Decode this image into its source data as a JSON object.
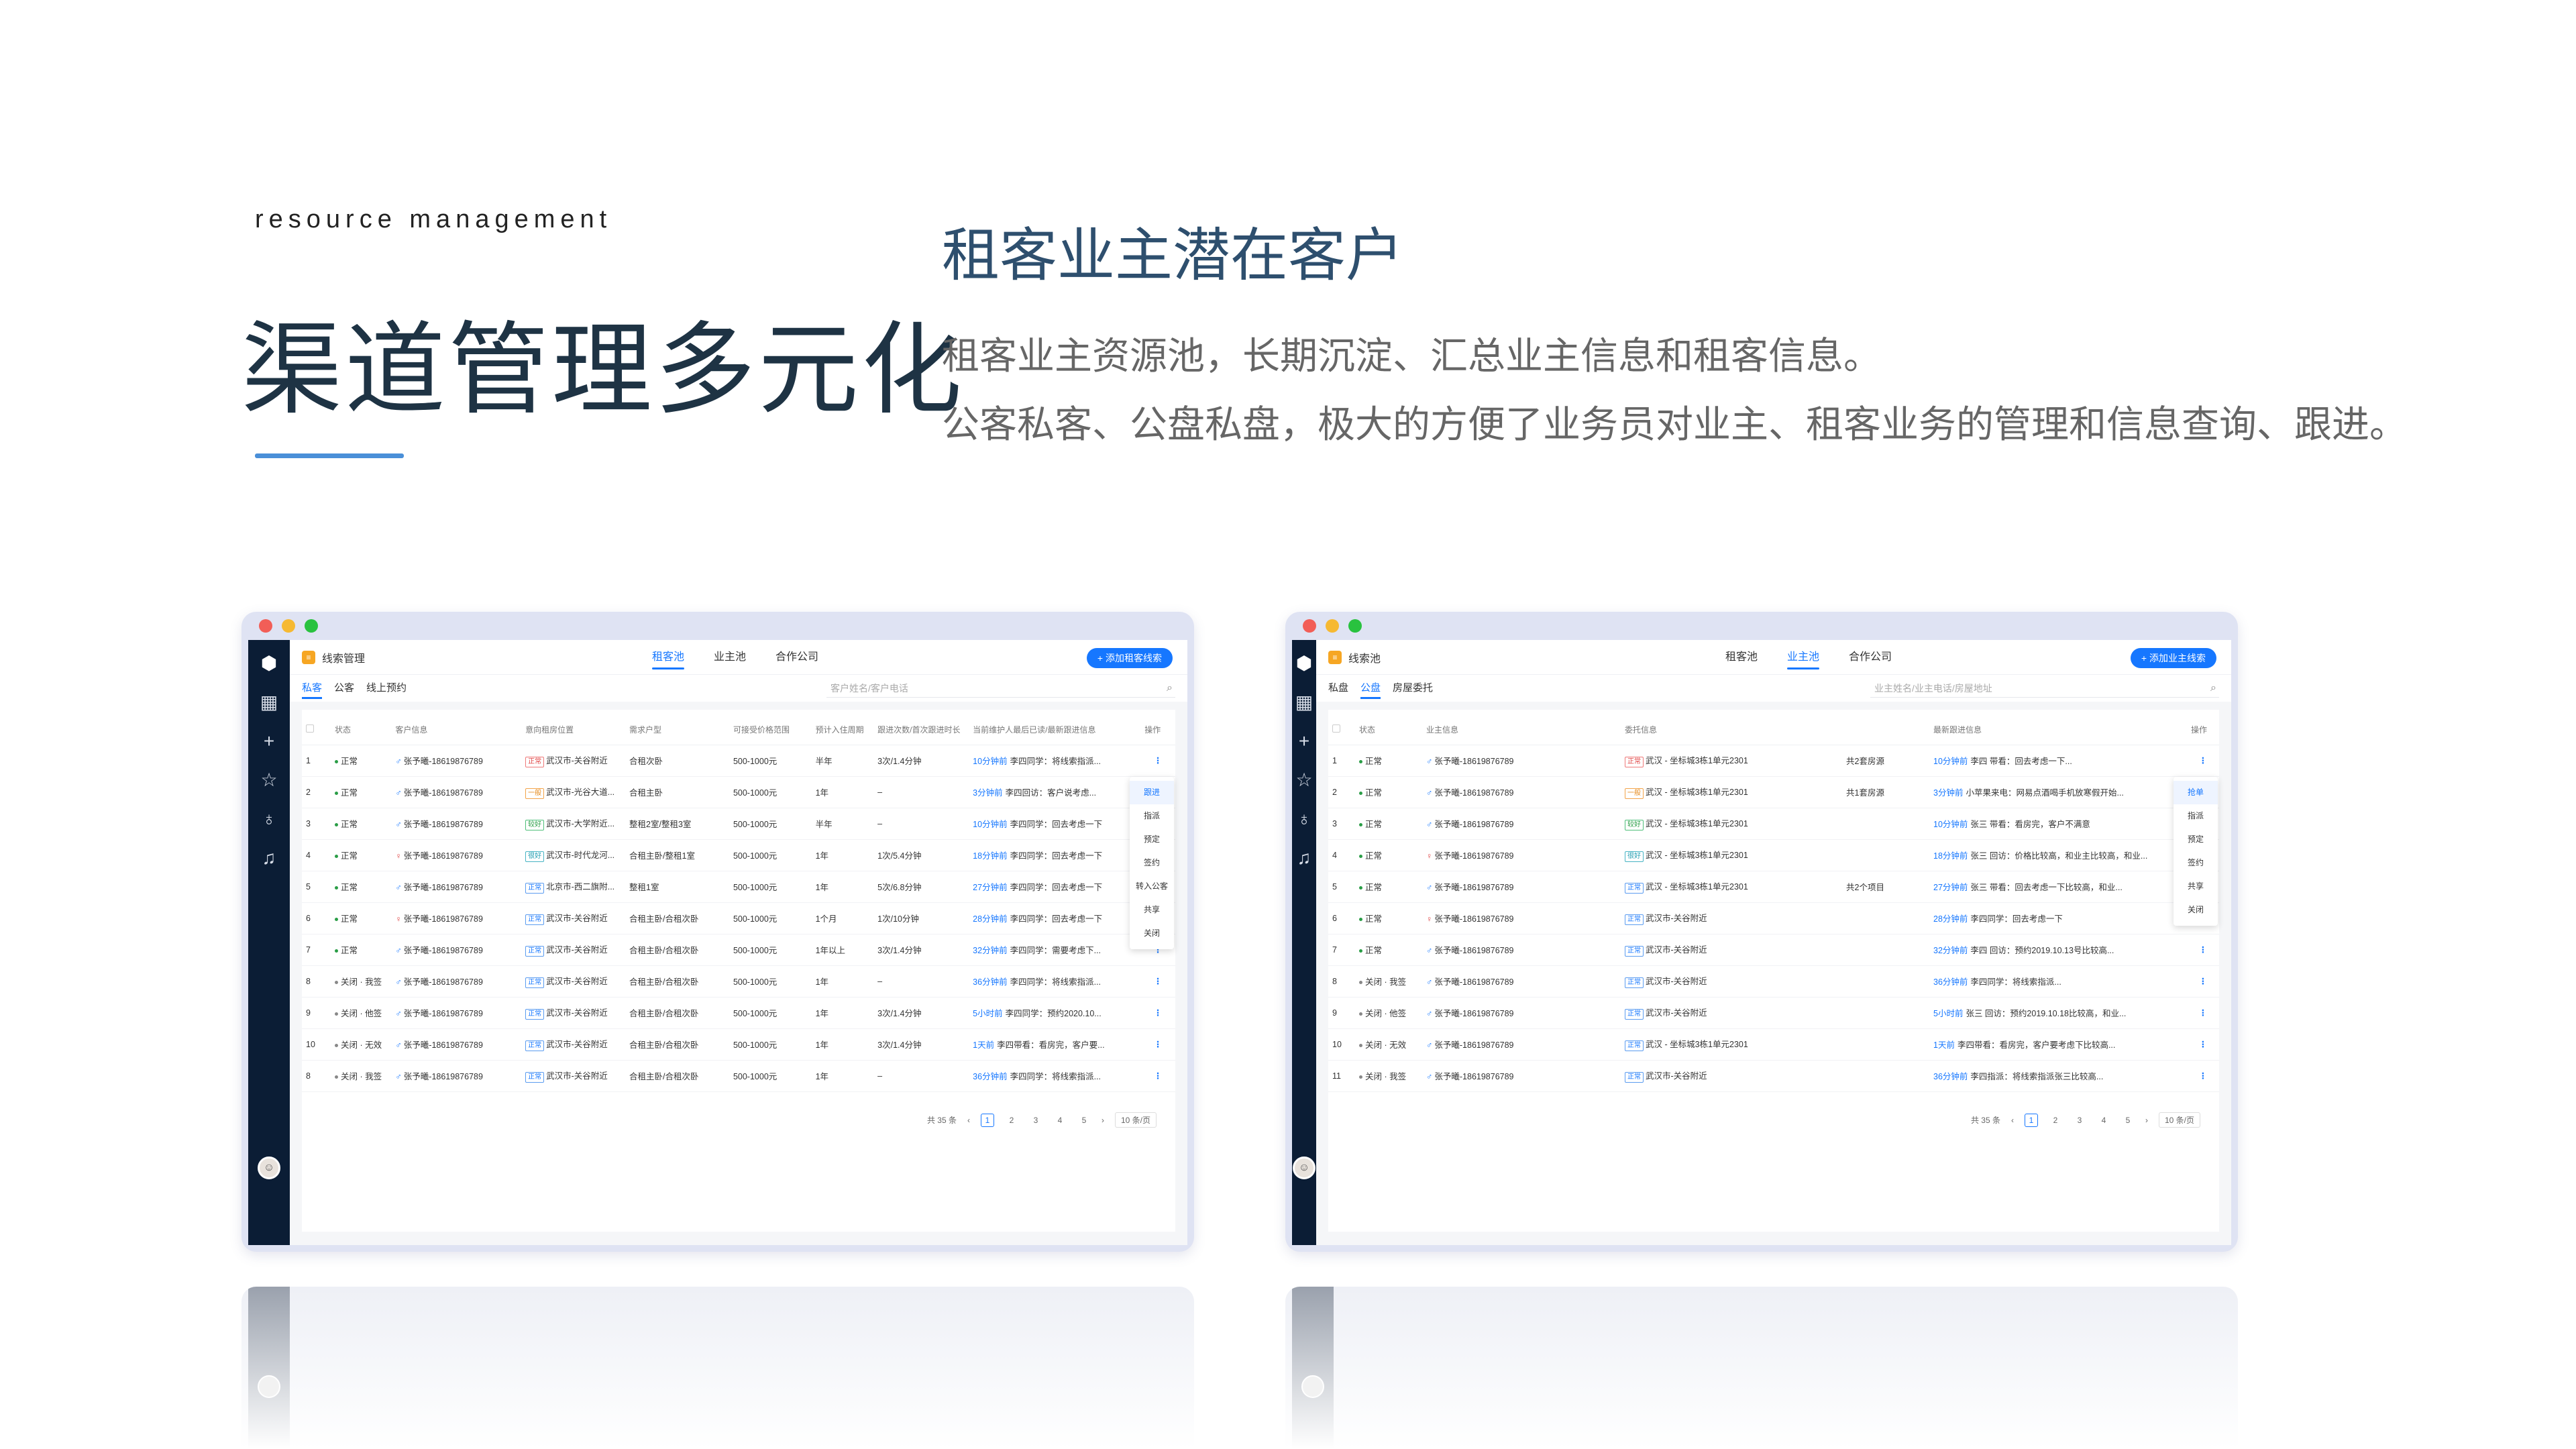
{
  "header": {
    "eyebrow": "resource management",
    "title": "渠道管理多元化",
    "section_title": "租客业主潜在客户",
    "desc1": "租客业主资源池，长期沉淀、汇总业主信息和租客信息。",
    "desc2": "公客私客、公盘私盘，极大的方便了业务员对业主、租客业务的管理和信息查询、跟进。"
  },
  "colors": {
    "accent": "#1677ff",
    "sidebar": "#0b1d35",
    "title": "#1e3344",
    "bar": "#4a8fd8"
  },
  "left": {
    "crumb": "线索管理",
    "tabs": [
      "租客池",
      "业主池",
      "合作公司"
    ],
    "active_tab": 0,
    "add_button": "+ 添加租客线索",
    "subtabs": [
      "私客",
      "公客",
      "线上预约"
    ],
    "search_placeholder": "客户姓名/客户电话",
    "columns": [
      "",
      "状态",
      "客户信息",
      "意向租房位置",
      "需求户型",
      "可接受价格范围",
      "预计入住周期",
      "跟进次数/首次跟进时长",
      "当前维护人最后已读/最新跟进信息",
      "操作"
    ],
    "rows": [
      {
        "no": "1",
        "status": "正常",
        "closed": false,
        "pin": "blue",
        "customer": "张予曦-18619876789",
        "tag": "正常",
        "tagc": "red",
        "loc": "武汉市-关谷附近",
        "type": "合租次卧",
        "price": "500-1000元",
        "period": "半年",
        "follow": "3次/1.4分钟",
        "time": "10分钟前",
        "info": "李四同学：将线索指派..."
      },
      {
        "no": "2",
        "status": "正常",
        "closed": false,
        "pin": "blue",
        "customer": "张予曦-18619876789",
        "tag": "一般",
        "tagc": "orange",
        "loc": "武汉市-光谷大道...",
        "type": "合租主卧",
        "price": "500-1000元",
        "period": "1年",
        "follow": "–",
        "time": "3分钟前",
        "info": "李四回访：客户说考虑..."
      },
      {
        "no": "3",
        "status": "正常",
        "closed": false,
        "pin": "blue",
        "customer": "张予曦-18619876789",
        "tag": "较好",
        "tagc": "green",
        "loc": "武汉市-大学附近...",
        "type": "整租2室/整租3室",
        "price": "500-1000元",
        "period": "半年",
        "follow": "–",
        "time": "10分钟前",
        "info": "李四同学：回去考虑一下"
      },
      {
        "no": "4",
        "status": "正常",
        "closed": false,
        "pin": "red",
        "customer": "张予曦-18619876789",
        "tag": "很好",
        "tagc": "teal",
        "loc": "武汉市-时代龙河...",
        "type": "合租主卧/整租1室",
        "price": "500-1000元",
        "period": "1年",
        "follow": "1次/5.4分钟",
        "time": "18分钟前",
        "info": "李四同学：回去考虑一下"
      },
      {
        "no": "5",
        "status": "正常",
        "closed": false,
        "pin": "blue",
        "customer": "张予曦-18619876789",
        "tag": "正常",
        "tagc": "blue",
        "loc": "北京市-西二旗附...",
        "type": "整租1室",
        "price": "500-1000元",
        "period": "1年",
        "follow": "5次/6.8分钟",
        "time": "27分钟前",
        "info": "李四同学：回去考虑一下"
      },
      {
        "no": "6",
        "status": "正常",
        "closed": false,
        "pin": "red",
        "customer": "张予曦-18619876789",
        "tag": "正常",
        "tagc": "blue",
        "loc": "武汉市-关谷附近",
        "type": "合租主卧/合租次卧",
        "price": "500-1000元",
        "period": "1个月",
        "follow": "1次/10分钟",
        "time": "28分钟前",
        "info": "李四同学：回去考虑一下"
      },
      {
        "no": "7",
        "status": "正常",
        "closed": false,
        "pin": "blue",
        "customer": "张予曦-18619876789",
        "tag": "正常",
        "tagc": "blue",
        "loc": "武汉市-关谷附近",
        "type": "合租主卧/合租次卧",
        "price": "500-1000元",
        "period": "1年以上",
        "follow": "3次/1.4分钟",
        "time": "32分钟前",
        "info": "李四同学：需要考虑下..."
      },
      {
        "no": "8",
        "status": "关闭 · 我签",
        "closed": true,
        "pin": "blue",
        "customer": "张予曦-18619876789",
        "tag": "正常",
        "tagc": "blue",
        "loc": "武汉市-关谷附近",
        "type": "合租主卧/合租次卧",
        "price": "500-1000元",
        "period": "1年",
        "follow": "–",
        "time": "36分钟前",
        "info": "李四同学：将线索指派..."
      },
      {
        "no": "9",
        "status": "关闭 · 他签",
        "closed": true,
        "pin": "blue",
        "customer": "张予曦-18619876789",
        "tag": "正常",
        "tagc": "blue",
        "loc": "武汉市-关谷附近",
        "type": "合租主卧/合租次卧",
        "price": "500-1000元",
        "period": "1年",
        "follow": "3次/1.4分钟",
        "time": "5小时前",
        "info": "李四同学：预约2020.10..."
      },
      {
        "no": "10",
        "status": "关闭 · 无效",
        "closed": true,
        "pin": "blue",
        "customer": "张予曦-18619876789",
        "tag": "正常",
        "tagc": "blue",
        "loc": "武汉市-关谷附近",
        "type": "合租主卧/合租次卧",
        "price": "500-1000元",
        "period": "1年",
        "follow": "3次/1.4分钟",
        "time": "1天前",
        "info": "李四带看：看房完，客户要..."
      },
      {
        "no": "8",
        "status": "关闭 · 我签",
        "closed": true,
        "pin": "blue",
        "customer": "张予曦-18619876789",
        "tag": "正常",
        "tagc": "blue",
        "loc": "武汉市-关谷附近",
        "type": "合租主卧/合租次卧",
        "price": "500-1000元",
        "period": "1年",
        "follow": "–",
        "time": "36分钟前",
        "info": "李四同学：将线索指派..."
      }
    ],
    "menu": [
      "跟进",
      "指派",
      "预定",
      "签约",
      "转入公客",
      "共享",
      "关闭"
    ],
    "pager": {
      "total": "共 35 条",
      "pages": [
        "1",
        "2",
        "3",
        "4",
        "5"
      ],
      "size": "10 条/页"
    }
  },
  "right": {
    "crumb": "线索池",
    "tabs": [
      "租客池",
      "业主池",
      "合作公司"
    ],
    "active_tab": 1,
    "add_button": "+ 添加业主线索",
    "subtabs": [
      "私盘",
      "公盘",
      "房屋委托"
    ],
    "search_placeholder": "业主姓名/业主电话/房屋地址",
    "columns": [
      "",
      "状态",
      "业主信息",
      "委托信息",
      "",
      "最新跟进信息",
      "操作"
    ],
    "rows": [
      {
        "no": "1",
        "status": "正常",
        "closed": false,
        "pin": "blue",
        "owner": "张予曦-18619876789",
        "tag": "正常",
        "tagc": "red",
        "entrust": "武汉 - 坐标城3栋1单元2301",
        "count": "共2套房源",
        "time": "10分钟前",
        "info": "李四 带看：回去考虑一下..."
      },
      {
        "no": "2",
        "status": "正常",
        "closed": false,
        "pin": "blue",
        "owner": "张予曦-18619876789",
        "tag": "一般",
        "tagc": "orange",
        "entrust": "武汉 - 坐标城3栋1单元2301",
        "count": "共1套房源",
        "time": "3分钟前",
        "info": "小苹果来电：网易点酒喝手机放寒假开始..."
      },
      {
        "no": "3",
        "status": "正常",
        "closed": false,
        "pin": "blue",
        "owner": "张予曦-18619876789",
        "tag": "较好",
        "tagc": "green",
        "entrust": "武汉 - 坐标城3栋1单元2301",
        "count": "",
        "time": "10分钟前",
        "info": "张三 带看：看房完，客户不满意"
      },
      {
        "no": "4",
        "status": "正常",
        "closed": false,
        "pin": "red",
        "owner": "张予曦-18619876789",
        "tag": "很好",
        "tagc": "teal",
        "entrust": "武汉 - 坐标城3栋1单元2301",
        "count": "",
        "time": "18分钟前",
        "info": "张三 回访：价格比较高，和业主比较高，和业..."
      },
      {
        "no": "5",
        "status": "正常",
        "closed": false,
        "pin": "blue",
        "owner": "张予曦-18619876789",
        "tag": "正常",
        "tagc": "blue",
        "entrust": "武汉 - 坐标城3栋1单元2301",
        "count": "共2个项目",
        "time": "27分钟前",
        "info": "张三 带看：回去考虑一下比较高，和业..."
      },
      {
        "no": "6",
        "status": "正常",
        "closed": false,
        "pin": "red",
        "owner": "张予曦-18619876789",
        "tag": "正常",
        "tagc": "blue",
        "entrust": "武汉市-关谷附近",
        "count": "",
        "time": "28分钟前",
        "info": "李四同学：回去考虑一下"
      },
      {
        "no": "7",
        "status": "正常",
        "closed": false,
        "pin": "blue",
        "owner": "张予曦-18619876789",
        "tag": "正常",
        "tagc": "blue",
        "entrust": "武汉市-关谷附近",
        "count": "",
        "time": "32分钟前",
        "info": "李四 回访：预约2019.10.13号比较高..."
      },
      {
        "no": "8",
        "status": "关闭 · 我签",
        "closed": true,
        "pin": "blue",
        "owner": "张予曦-18619876789",
        "tag": "正常",
        "tagc": "blue",
        "entrust": "武汉市-关谷附近",
        "count": "",
        "time": "36分钟前",
        "info": "李四同学：将线索指派..."
      },
      {
        "no": "9",
        "status": "关闭 · 他签",
        "closed": true,
        "pin": "blue",
        "owner": "张予曦-18619876789",
        "tag": "正常",
        "tagc": "blue",
        "entrust": "武汉市-关谷附近",
        "count": "",
        "time": "5小时前",
        "info": "张三 回访：预约2019.10.18比较高，和业..."
      },
      {
        "no": "10",
        "status": "关闭 · 无效",
        "closed": true,
        "pin": "blue",
        "owner": "张予曦-18619876789",
        "tag": "正常",
        "tagc": "blue",
        "entrust": "武汉 - 坐标城3栋1单元2301",
        "count": "",
        "time": "1天前",
        "info": "李四带看：看房完，客户要考虑下比较高..."
      },
      {
        "no": "11",
        "status": "关闭 · 我签",
        "closed": true,
        "pin": "blue",
        "owner": "张予曦-18619876789",
        "tag": "正常",
        "tagc": "blue",
        "entrust": "武汉市-关谷附近",
        "count": "",
        "time": "36分钟前",
        "info": "李四指派：将线索指派张三比较高..."
      }
    ],
    "menu": [
      "抢单",
      "指派",
      "预定",
      "签约",
      "共享",
      "关闭"
    ],
    "pager": {
      "total": "共 35 条",
      "pages": [
        "1",
        "2",
        "3",
        "4",
        "5"
      ],
      "size": "10 条/页"
    }
  }
}
